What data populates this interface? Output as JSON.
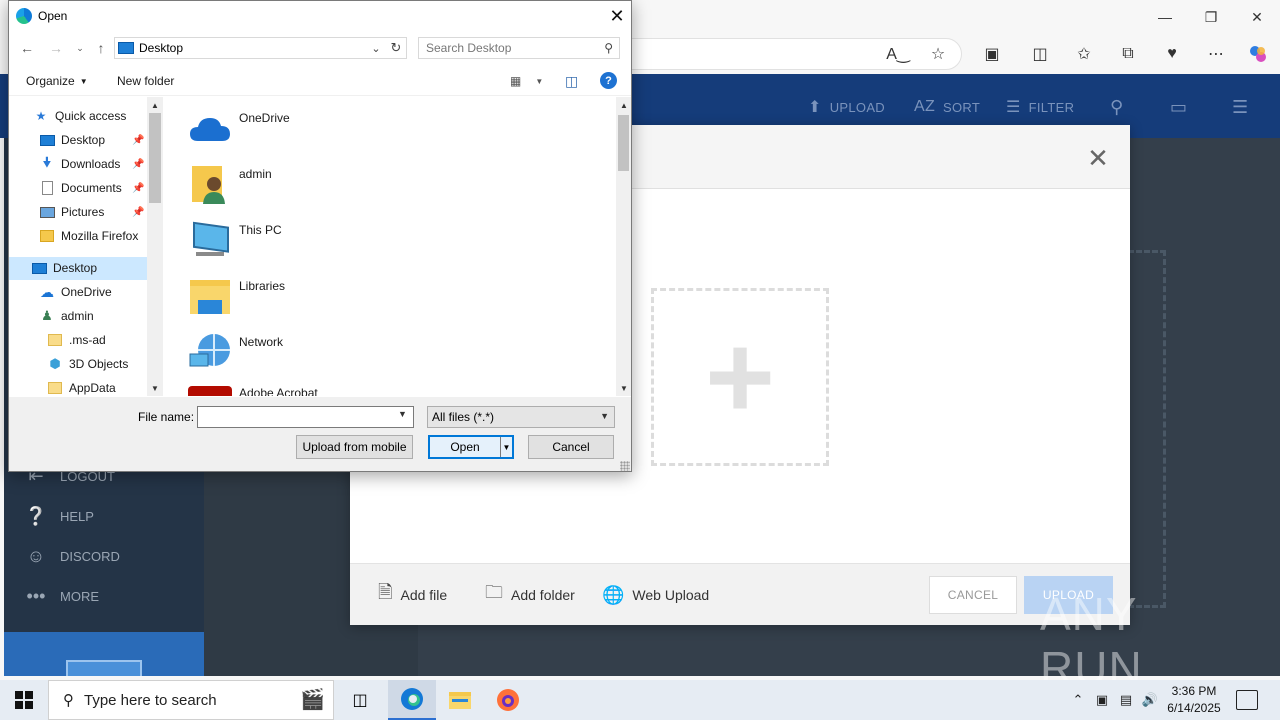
{
  "dialog": {
    "title": "Open",
    "path": "Desktop",
    "search_placeholder": "Search Desktop",
    "organize_label": "Organize",
    "new_folder_label": "New folder",
    "help_label": "?",
    "nav_items": [
      {
        "label": "Quick access"
      },
      {
        "label": "Desktop"
      },
      {
        "label": "Downloads"
      },
      {
        "label": "Documents"
      },
      {
        "label": "Pictures"
      },
      {
        "label": "Mozilla Firefox"
      },
      {
        "label": "Desktop"
      },
      {
        "label": "OneDrive"
      },
      {
        "label": "admin"
      },
      {
        "label": ".ms-ad"
      },
      {
        "label": "3D Objects"
      },
      {
        "label": "AppData"
      }
    ],
    "files": [
      {
        "label": "OneDrive"
      },
      {
        "label": "admin"
      },
      {
        "label": "This PC"
      },
      {
        "label": "Libraries"
      },
      {
        "label": "Network"
      },
      {
        "label": "Adobe Acrobat"
      }
    ],
    "file_name_label": "File name:",
    "file_name_value": "",
    "filter_value": "All files (*.*)",
    "upload_from_mobile_label": "Upload from mobile",
    "open_label": "Open",
    "cancel_label": "Cancel"
  },
  "app": {
    "header": {
      "upload": "UPLOAD",
      "sort": "SORT",
      "sort_icon": "AZ",
      "filter": "FILTER"
    },
    "sidebar": {
      "logout": "LOGOUT",
      "help": "HELP",
      "discord": "DISCORD",
      "more": "MORE"
    },
    "modal": {
      "add_file": "Add file",
      "add_folder": "Add folder",
      "web_upload": "Web Upload",
      "cancel": "CANCEL",
      "upload": "UPLOAD"
    },
    "watermark": "ANY RUN"
  },
  "taskbar": {
    "search_placeholder": "Type here to search",
    "time": "3:36 PM",
    "date": "6/14/2025"
  },
  "colors": {
    "app_header": "#153c7a",
    "app_sidebar": "#243447",
    "accent": "#0078d7",
    "upload_disabled": "#b9d3f3"
  }
}
